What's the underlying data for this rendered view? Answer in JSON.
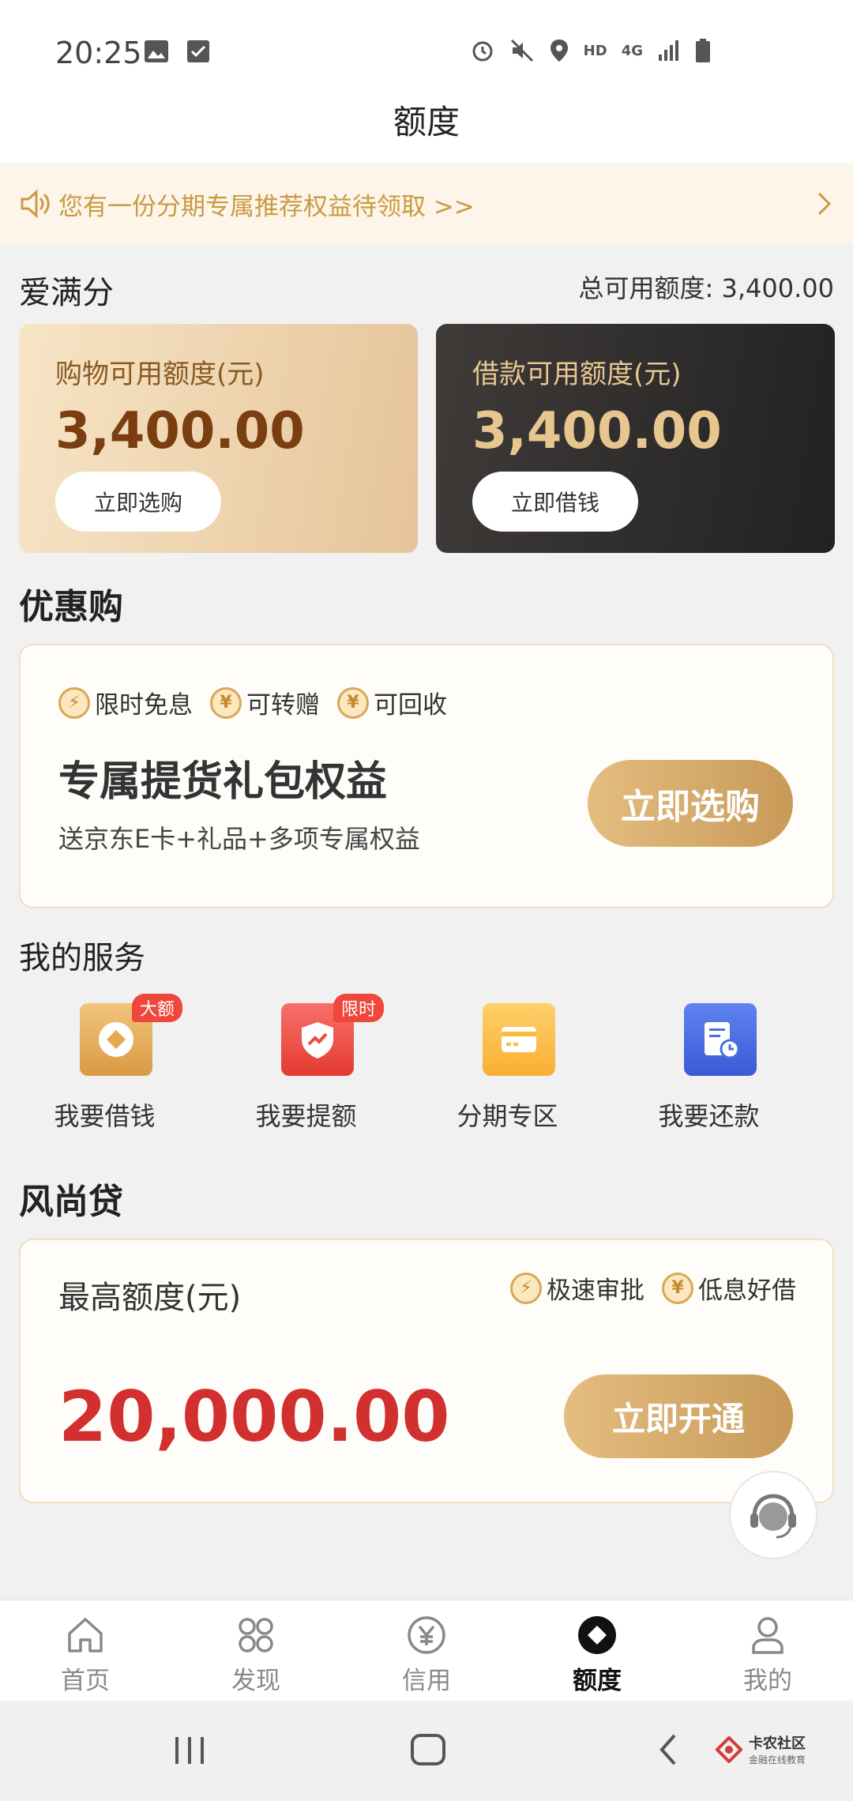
{
  "status": {
    "time": "20:25",
    "hd": "HD",
    "net": "4G"
  },
  "header": {
    "title": "额度"
  },
  "notice": {
    "text": "您有一份分期专属推荐权益待领取 >>"
  },
  "credit": {
    "section_title": "爱满分",
    "total": "总可用额度: 3,400.00",
    "shopping": {
      "label": "购物可用额度(元)",
      "amount": "3,400.00",
      "button": "立即选购"
    },
    "loan": {
      "label": "借款可用额度(元)",
      "amount": "3,400.00",
      "button": "立即借钱"
    }
  },
  "promo": {
    "section_title": "优惠购",
    "tags": [
      "限时免息",
      "可转赠",
      "可回收"
    ],
    "title": "专属提货礼包权益",
    "subtitle": "送京东E卡+礼品+多项专属权益",
    "button": "立即选购"
  },
  "services": {
    "section_title": "我的服务",
    "items": [
      {
        "label": "我要借钱",
        "badge": "大额",
        "icon": "diamond-coin-icon",
        "color": "#e4a84e"
      },
      {
        "label": "我要提额",
        "badge": "限时",
        "icon": "shield-trend-icon",
        "color": "#ef4a3f"
      },
      {
        "label": "分期专区",
        "badge": "",
        "icon": "card-icon",
        "color": "#f9be3d"
      },
      {
        "label": "我要还款",
        "badge": "",
        "icon": "bill-clock-icon",
        "color": "#4a6fe0"
      }
    ]
  },
  "fengshang": {
    "section_title": "风尚贷",
    "label": "最高额度(元)",
    "tags": [
      "极速审批",
      "低息好借"
    ],
    "amount": "20,000.00",
    "button": "立即开通"
  },
  "tabs": [
    {
      "label": "首页",
      "icon": "home-icon",
      "active": false
    },
    {
      "label": "发现",
      "icon": "grid-icon",
      "active": false
    },
    {
      "label": "信用",
      "icon": "yen-icon",
      "active": false
    },
    {
      "label": "额度",
      "icon": "diamond-icon",
      "active": true
    },
    {
      "label": "我的",
      "icon": "user-icon",
      "active": false
    }
  ],
  "watermark": {
    "title": "卡农社区",
    "subtitle": "金融在线教育"
  },
  "colors": {
    "gold": "#c99a43",
    "red": "#d22f2f",
    "accent_bg": "#fdf5e9"
  }
}
